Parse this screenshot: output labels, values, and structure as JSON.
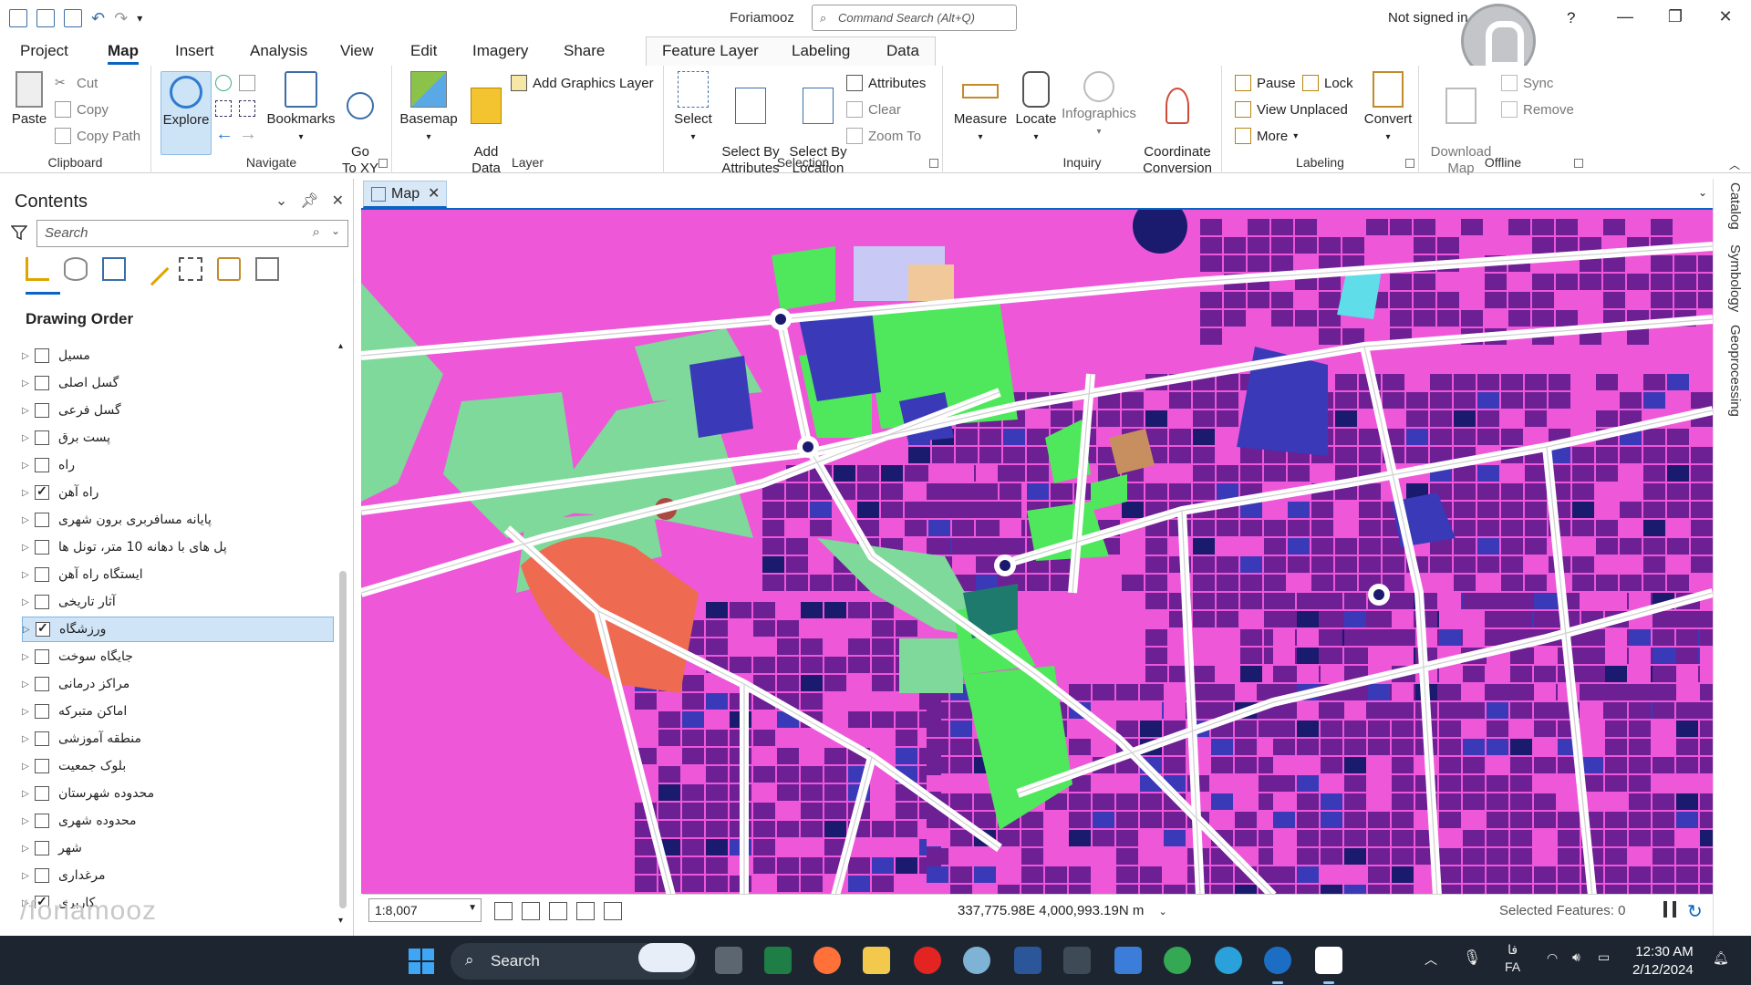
{
  "window": {
    "title": "Foriamooz",
    "command_search_placeholder": "Command Search (Alt+Q)",
    "signin": "Not signed in"
  },
  "tabs": [
    {
      "label": "Project"
    },
    {
      "label": "Map",
      "active": true
    },
    {
      "label": "Insert"
    },
    {
      "label": "Analysis"
    },
    {
      "label": "View"
    },
    {
      "label": "Edit"
    },
    {
      "label": "Imagery"
    },
    {
      "label": "Share"
    },
    {
      "label": "Feature Layer"
    },
    {
      "label": "Labeling"
    },
    {
      "label": "Data"
    }
  ],
  "ribbon": {
    "clipboard": {
      "label": "Clipboard",
      "paste": "Paste",
      "cut": "Cut",
      "copy": "Copy",
      "copy_path": "Copy Path"
    },
    "navigate": {
      "label": "Navigate",
      "explore": "Explore",
      "bookmarks": "Bookmarks",
      "goto": "Go\nTo XY"
    },
    "layer": {
      "label": "Layer",
      "basemap": "Basemap",
      "add_data": "Add\nData",
      "add_graphics": "Add Graphics Layer"
    },
    "selection": {
      "label": "Selection",
      "select": "Select",
      "select_by_attr": "Select By\nAttributes",
      "select_by_loc": "Select By\nLocation",
      "attributes": "Attributes",
      "clear": "Clear",
      "zoom_to": "Zoom To"
    },
    "inquiry": {
      "label": "Inquiry",
      "measure": "Measure",
      "locate": "Locate",
      "infographics": "Infographics",
      "coord_conv": "Coordinate\nConversion"
    },
    "labeling": {
      "label": "Labeling",
      "pause": "Pause",
      "lock": "Lock",
      "view_unplaced": "View Unplaced",
      "more": "More",
      "convert": "Convert"
    },
    "offline": {
      "label": "Offline",
      "download_map": "Download\nMap",
      "sync": "Sync",
      "remove": "Remove"
    }
  },
  "contents": {
    "title": "Contents",
    "search_placeholder": "Search",
    "drawing_order": "Drawing Order",
    "layers": [
      {
        "name": "مسیل",
        "checked": false
      },
      {
        "name": "گسل اصلی",
        "checked": false
      },
      {
        "name": "گسل فرعی",
        "checked": false
      },
      {
        "name": "پست برق",
        "checked": false
      },
      {
        "name": "راه",
        "checked": false
      },
      {
        "name": "راه آهن",
        "checked": true
      },
      {
        "name": "پایانه مسافربری برون شهری",
        "checked": false
      },
      {
        "name": "پل های با دهانه 10 متر، تونل ها",
        "checked": false
      },
      {
        "name": "ایستگاه راه آهن",
        "checked": false
      },
      {
        "name": "آثار تاریخی",
        "checked": false
      },
      {
        "name": "ورزشگاه",
        "checked": true,
        "selected": true
      },
      {
        "name": "جایگاه سوخت",
        "checked": false
      },
      {
        "name": "مراکز درمانی",
        "checked": false
      },
      {
        "name": "اماکن متبرکه",
        "checked": false
      },
      {
        "name": "منطقه آموزشی",
        "checked": false
      },
      {
        "name": "بلوک جمعیت",
        "checked": false
      },
      {
        "name": "محدوده شهرستان",
        "checked": false
      },
      {
        "name": "محدوده شهری",
        "checked": false
      },
      {
        "name": "شهر",
        "checked": false
      },
      {
        "name": "مرغداری",
        "checked": false
      },
      {
        "name": "کاربری",
        "checked": true
      }
    ],
    "brand_watermark": "/foriamooz"
  },
  "map": {
    "tab_label": "Map",
    "scale": "1:8,007",
    "coordinates": "337,775.98E 4,000,993.19N m",
    "selected_features": "Selected Features: 0",
    "colors": {
      "residential": "#6d1f94",
      "commercial": "#ee58d8",
      "green": "#4fe85c",
      "park": "#7fd99a",
      "navy": "#1a1a6e",
      "blue": "#3a3ab8",
      "orange": "#ee6a50",
      "road": "#ffffff"
    }
  },
  "side_tabs": [
    "Catalog",
    "Symbology",
    "Geoprocessing"
  ],
  "taskbar": {
    "search": "Search",
    "lang_top": "فا",
    "lang": "FA",
    "time": "12:30 AM",
    "date": "2/12/2024"
  }
}
